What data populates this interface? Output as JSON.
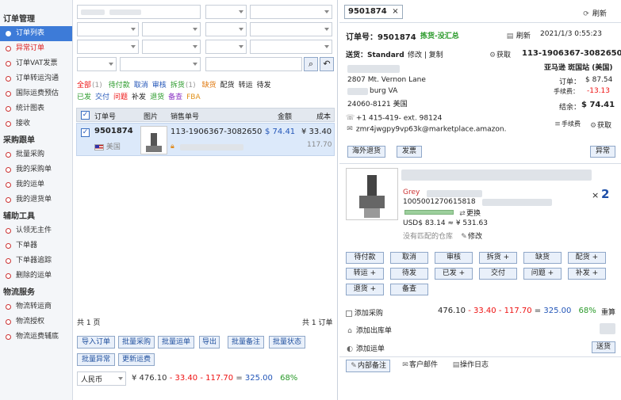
{
  "sidebar": {
    "groups": [
      {
        "title": "订单管理",
        "items": [
          {
            "label": "订单列表",
            "active": true
          },
          {
            "label": "异常订单",
            "red": true
          },
          {
            "label": "订单VAT发票"
          },
          {
            "label": "订单转运沟通"
          },
          {
            "label": "国际运费预估"
          },
          {
            "label": "统计图表"
          },
          {
            "label": "接收"
          }
        ]
      },
      {
        "title": "采购跟单",
        "items": [
          {
            "label": "批量采购"
          },
          {
            "label": "我的采购单"
          },
          {
            "label": "我的运单"
          },
          {
            "label": "我的退货单"
          }
        ]
      },
      {
        "title": "辅助工具",
        "items": [
          {
            "label": "认领无主件"
          },
          {
            "label": "下单器"
          },
          {
            "label": "下单器追踪"
          },
          {
            "label": "删除的运单"
          }
        ]
      },
      {
        "title": "物流服务",
        "items": [
          {
            "label": "物流转运商"
          },
          {
            "label": "物流授权"
          },
          {
            "label": "物流运费辅底"
          }
        ]
      }
    ]
  },
  "list": {
    "status_row1": [
      {
        "label": "全部",
        "count": "(1)",
        "color": "red"
      },
      {
        "label": "待付款",
        "color": "green"
      },
      {
        "label": "取消",
        "color": "blue"
      },
      {
        "label": "审核",
        "color": "blue"
      },
      {
        "label": "拆货",
        "count": "(1)",
        "color": "green"
      },
      {
        "label": "缺货",
        "color": "orange"
      },
      {
        "label": "配货",
        "color": "black"
      },
      {
        "label": "转运",
        "color": "black"
      },
      {
        "label": "待发",
        "color": "black"
      }
    ],
    "status_row2": [
      {
        "label": "已发",
        "color": "green"
      },
      {
        "label": "交付",
        "color": "blue"
      },
      {
        "label": "问题",
        "color": "red"
      },
      {
        "label": "补发",
        "color": "black"
      },
      {
        "label": "退货",
        "color": "green"
      },
      {
        "label": "备查",
        "color": "purple"
      },
      {
        "label": "FBA",
        "color": "fba"
      }
    ],
    "columns": {
      "order_no": "订单号",
      "image": "图片",
      "sales_no": "销售单号",
      "amount": "金额",
      "cost": "成本"
    },
    "row": {
      "order_no": "9501874",
      "country": "美国",
      "sales_no": "113-1906367-3082650",
      "amount": "$ 74.41",
      "cost": "¥ 33.40",
      "cost2": "117.70"
    },
    "page_total": "共 1 页",
    "order_total": "共 1 订单",
    "buttons": [
      "导入订单",
      "批量采购",
      "批量运单",
      "导出",
      "批量备注",
      "批量状态",
      "批量异常",
      "更新运费"
    ],
    "currency": "人民币",
    "summary": {
      "base": "¥ 476.10",
      "c1": "33.40",
      "c2": "117.70",
      "result": "325.00",
      "pct": "68%"
    }
  },
  "detail": {
    "tab": "9501874",
    "refresh": "刷新",
    "order_label": "订单号：9501874",
    "order_status": "拣货-没汇总",
    "order_refresh": "刷新",
    "datetime": "2021/1/3 0:55:23",
    "ship_label": "送货：Standard",
    "edit": "修改",
    "copy": "复制",
    "fetch": "获取",
    "sales_no": "113-1906367-3082650",
    "store": "亚马逊 斑国站 (美国)",
    "address1": "2807 Mt. Vernon Lane",
    "address2": "burg  VA",
    "address3": "24060-8121  美国",
    "order_amount_label": "订单：",
    "order_amount": "$ 87.54",
    "fee_label": "手续费：",
    "fee": "-13.13",
    "settle_label": "结余：",
    "settle": "$ 74.41",
    "phone": "+1 415-419-      ext. 98124",
    "email": "zmr4jwgpy9vp63k@marketplace.amazon.",
    "manual_fee": "手续费",
    "fetch2": "获取",
    "btn_overseas_return": "海外退货",
    "btn_invoice": "发票",
    "btn_abnormal": "异常",
    "product_color": "Grey",
    "product_sku": "1005001270615818",
    "product_change": "更换",
    "product_price": "USD$ 83.14 ≈ ¥ 531.63",
    "no_warehouse": "没有匹配的仓库",
    "modify": "修改",
    "qty_x": "×",
    "qty": "2",
    "grid_buttons": [
      [
        "待付款",
        "取消",
        "审核",
        "拆货 +",
        "缺货",
        "配货 +"
      ],
      [
        "转运 +",
        "待发",
        "已发 +",
        "交付",
        "问题 +",
        "补发 +"
      ],
      [
        "退货 +",
        "备查"
      ]
    ],
    "add_purchase": "添加采购",
    "calc": {
      "base": "476.10",
      "c1": "33.40",
      "c2": "117.70",
      "result": "325.00",
      "pct": "68%"
    },
    "recalc": "重算",
    "add_outbound": "添加出库单",
    "add_waybill": "添加运单",
    "send": "送货",
    "bottom_tabs": [
      "内部备注",
      "客户邮件",
      "操作日志"
    ]
  }
}
